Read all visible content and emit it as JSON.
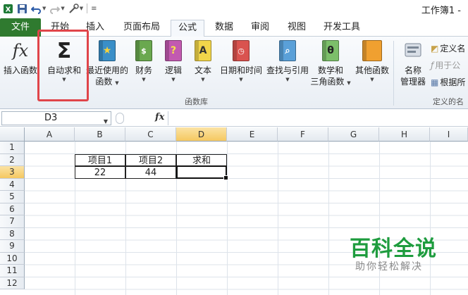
{
  "window": {
    "title": "工作簿1 -"
  },
  "tabs": [
    {
      "label": "文件"
    },
    {
      "label": "开始"
    },
    {
      "label": "插入"
    },
    {
      "label": "页面布局"
    },
    {
      "label": "公式"
    },
    {
      "label": "数据"
    },
    {
      "label": "审阅"
    },
    {
      "label": "视图"
    },
    {
      "label": "开发工具"
    }
  ],
  "ribbon": {
    "insert_function": "插入函数",
    "autosum": "自动求和",
    "recent_line1": "最近使用的",
    "recent_line2": "函数",
    "financial": "财务",
    "logical": "逻辑",
    "text": "文本",
    "datetime": "日期和时间",
    "lookup": "查找与引用",
    "math_line1": "数学和",
    "math_line2": "三角函数",
    "more": "其他函数",
    "name_mgr_line1": "名称",
    "name_mgr_line2": "管理器",
    "define_name": "定义名",
    "use_in_formula": "用于公",
    "create_from_sel": "根据所",
    "group_library": "函数库",
    "group_defined": "定义的名",
    "icon_fx": "fx",
    "icon_sigma": "Σ",
    "icon_logical": "?",
    "icon_text": "A",
    "icon_math": "θ"
  },
  "formula_bar": {
    "name_box": "D3",
    "fx_label": "fx",
    "value": ""
  },
  "columns": [
    "A",
    "B",
    "C",
    "D",
    "E",
    "F",
    "G",
    "H",
    "I"
  ],
  "rows": [
    "1",
    "2",
    "3",
    "4",
    "5",
    "6",
    "7",
    "8",
    "9",
    "10",
    "11",
    "12"
  ],
  "cells": {
    "B2": "项目1",
    "C2": "项目2",
    "D2": "求和",
    "B3": "22",
    "C3": "44",
    "D3": ""
  },
  "watermark": {
    "title": "百科全说",
    "subtitle": "助你轻松解决"
  },
  "colors": {
    "file_tab": "#2f7a2f",
    "highlight": "#e0454a",
    "selected_header": "#f5c860",
    "watermark_green": "#1e9c3e"
  }
}
